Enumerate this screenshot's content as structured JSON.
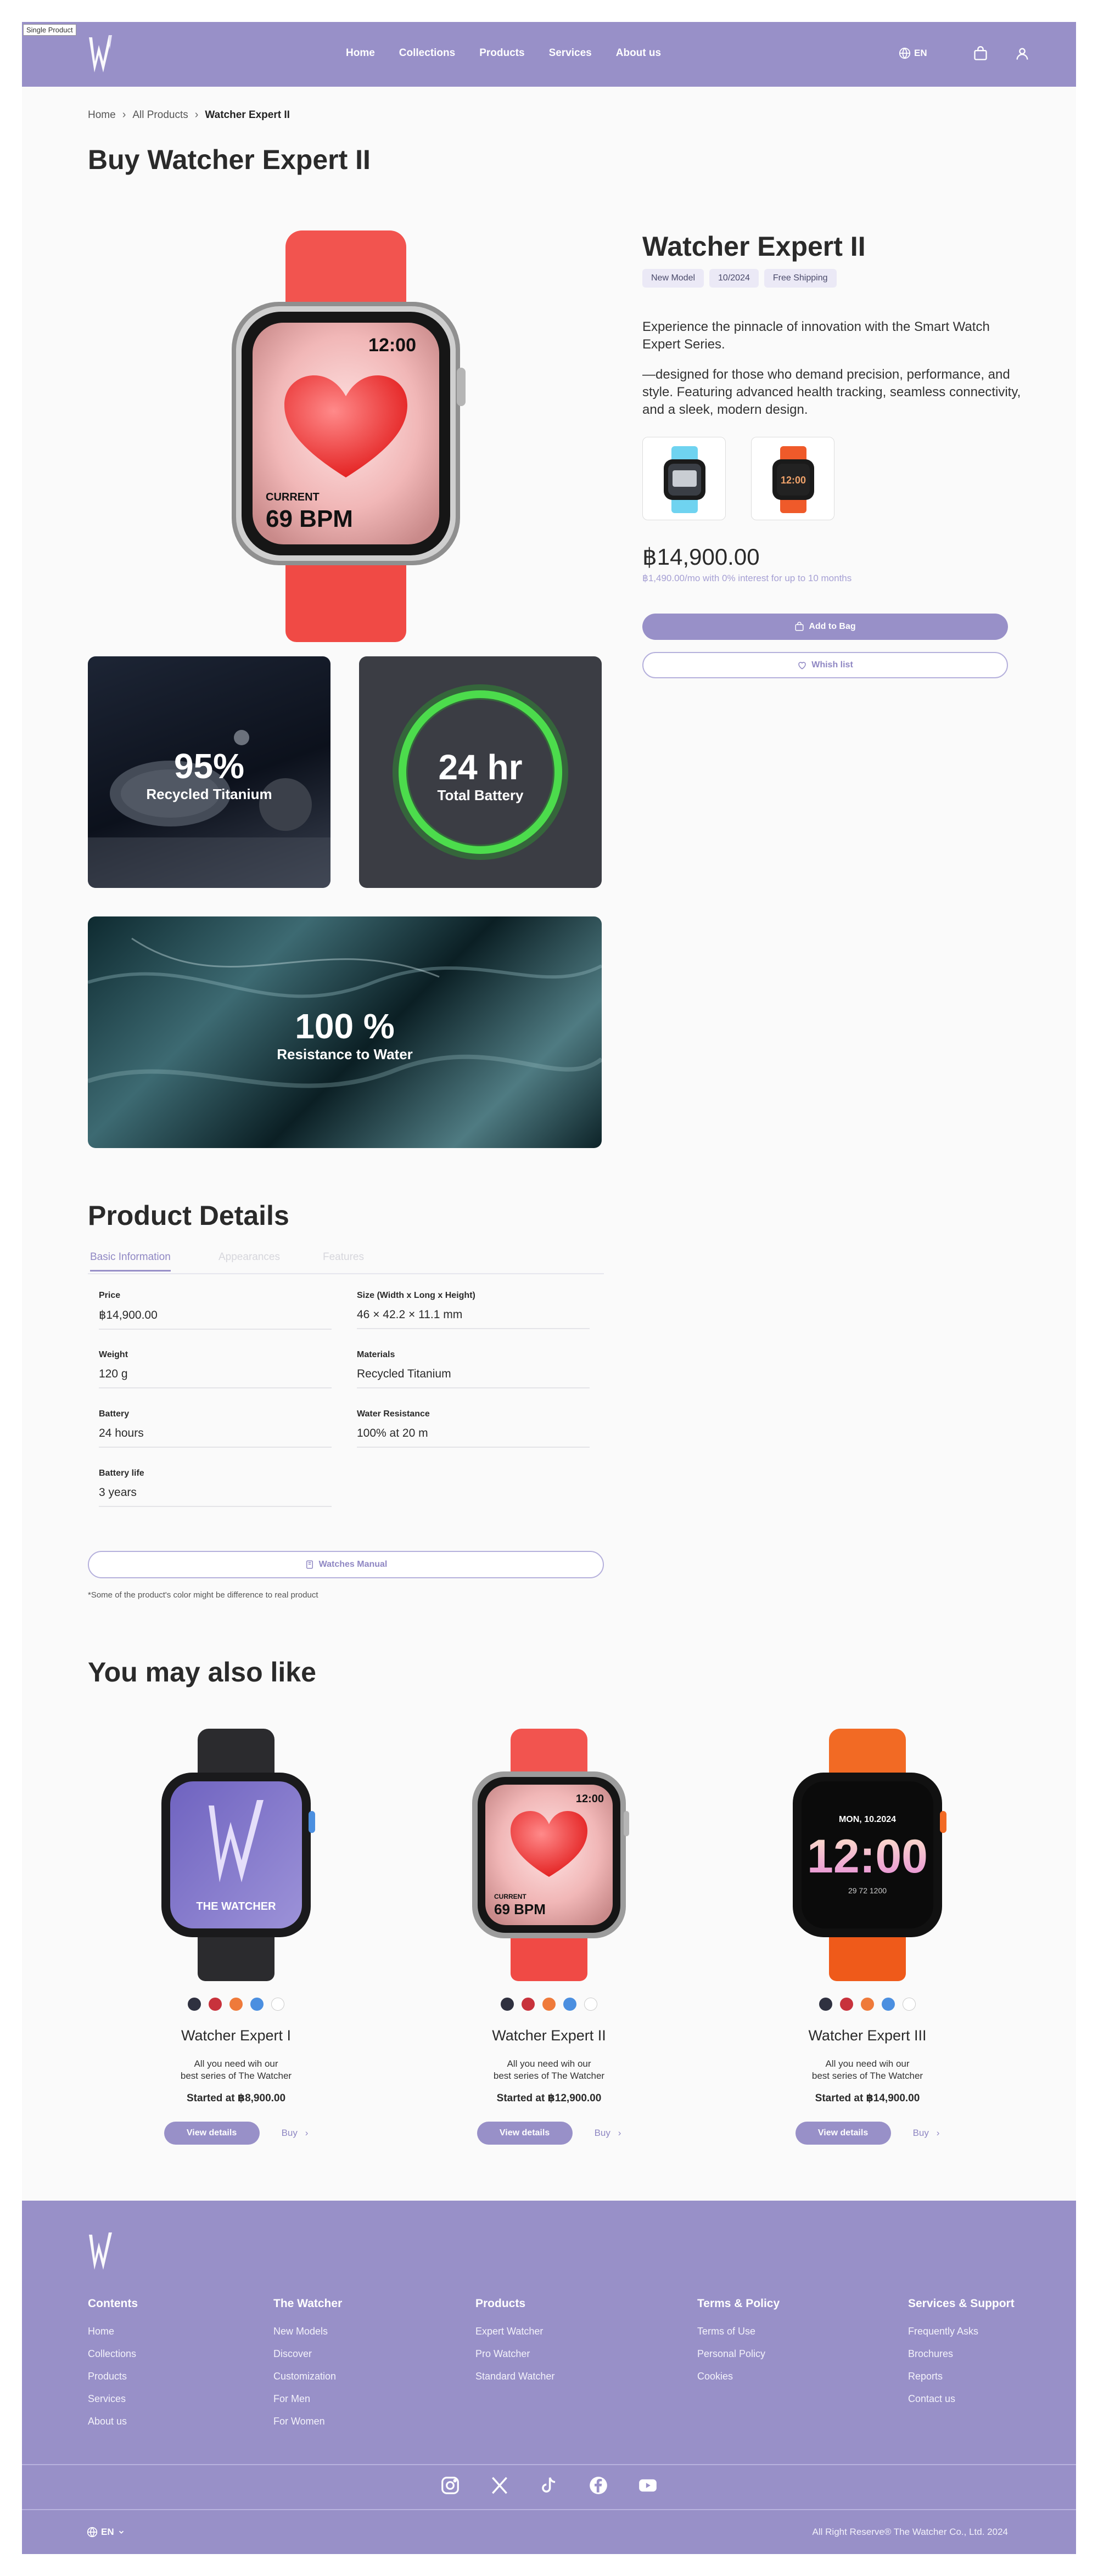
{
  "frame_label": "Single Product",
  "header": {
    "nav": [
      "Home",
      "Collections",
      "Products",
      "Services",
      "About us"
    ],
    "lang": "EN"
  },
  "breadcrumb": [
    "Home",
    "All Products",
    "Watcher Expert II"
  ],
  "page_title": "Buy Watcher Expert II",
  "hero": {
    "screen_time": "12:00",
    "screen_label": "CURRENT",
    "screen_bpm": "69 BPM"
  },
  "feature_tiles": [
    {
      "value": "95%",
      "label": "Recycled Titanium"
    },
    {
      "value": "24 hr",
      "label": "Total Battery"
    },
    {
      "value": "100 %",
      "label": "Resistance to Water"
    }
  ],
  "product": {
    "name": "Watcher Expert II",
    "tags": [
      "New Model",
      "10/2024",
      "Free Shipping"
    ],
    "description": [
      "Experience the pinnacle of innovation with the Smart Watch Expert Series.",
      "—designed for those who demand precision, performance, and style. Featuring advanced health tracking, seamless connectivity, and a sleek, modern design."
    ],
    "variant_screen_time": "12:00",
    "price": "฿14,900.00",
    "installment": "฿1,490.00/mo with 0% interest for up to 10 months",
    "add_to_bag": "Add to Bag",
    "wishlist": "Whish list"
  },
  "details": {
    "title": "Product Details",
    "tabs": [
      "Basic Information",
      "Appearances",
      "Features"
    ],
    "specs": [
      {
        "label": "Price",
        "value": "฿14,900.00"
      },
      {
        "label": "Size (Width x Long x Height)",
        "value": "46 × 42.2 × 11.1 mm"
      },
      {
        "label": "Weight",
        "value": "120 g"
      },
      {
        "label": "Materials",
        "value": "Recycled Titanium"
      },
      {
        "label": "Battery",
        "value": "24 hours"
      },
      {
        "label": "Water Resistance",
        "value": "100% at 20 m"
      },
      {
        "label": "Battery life",
        "value": "3 years"
      }
    ],
    "manual_button": "Watches Manual",
    "note": "*Some of the product's color might be difference to real product"
  },
  "also_like": {
    "title": "You may also like",
    "items": [
      {
        "name": "Watcher Expert I",
        "desc1": "All you need wih our",
        "desc2": "best series of The Watcher",
        "price": "Started at ฿8,900.00",
        "view": "View details",
        "buy": "Buy",
        "screen_text": "THE WATCHER",
        "swatches": [
          "#2f3140",
          "#c8323c",
          "#ef7a3a",
          "#4b8fe0",
          "#ffffff"
        ]
      },
      {
        "name": "Watcher Expert II",
        "desc1": "All you need wih our",
        "desc2": "best series of The Watcher",
        "price": "Started at ฿12,900.00",
        "view": "View details",
        "buy": "Buy",
        "screen_time": "12:00",
        "screen_label": "CURRENT",
        "screen_bpm": "69 BPM",
        "swatches": [
          "#2f3140",
          "#c8323c",
          "#ef7a3a",
          "#4b8fe0",
          "#ffffff"
        ]
      },
      {
        "name": "Watcher Expert III",
        "desc1": "All you need wih our",
        "desc2": "best series of The Watcher",
        "price": "Started at ฿14,900.00",
        "view": "View details",
        "buy": "Buy",
        "screen_date": "MON, 10.2024",
        "screen_time": "12:00",
        "screen_stats": "29   72   1200",
        "swatches": [
          "#2f3140",
          "#c8323c",
          "#ef7a3a",
          "#4b8fe0",
          "#ffffff"
        ]
      }
    ]
  },
  "footer": {
    "columns": [
      {
        "title": "Contents",
        "links": [
          "Home",
          "Collections",
          "Products",
          "Services",
          "About us"
        ]
      },
      {
        "title": "The Watcher",
        "links": [
          "New Models",
          "Discover",
          "Customization",
          "For Men",
          "For Women"
        ]
      },
      {
        "title": "Products",
        "links": [
          "Expert Watcher",
          "Pro Watcher",
          "Standard  Watcher"
        ]
      },
      {
        "title": "Terms & Policy",
        "links": [
          "Terms of Use",
          "Personal Policy",
          "Cookies"
        ]
      },
      {
        "title": "Services & Support",
        "links": [
          "Frequently Asks",
          "Brochures",
          "Reports",
          "Contact us"
        ]
      }
    ],
    "lang": "EN",
    "copyright": "All Right Reserve® The Watcher Co., Ltd. 2024"
  },
  "colors": {
    "brand": "#9890c8",
    "accent_light": "#ebe9f6",
    "text": "#2a2a2a"
  }
}
